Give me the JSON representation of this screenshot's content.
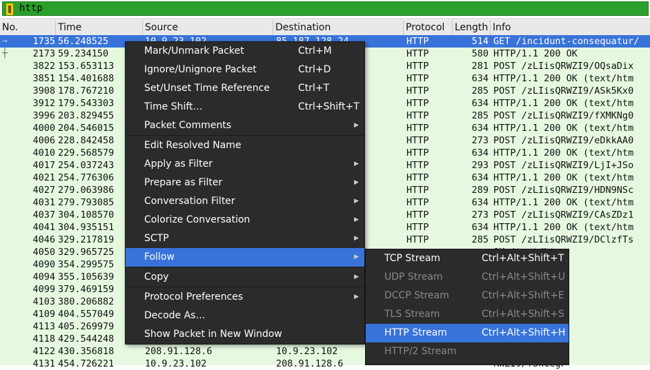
{
  "filter": {
    "text": "http",
    "bg_color": "#2ca02c"
  },
  "columns": [
    "No.",
    "Time",
    "Source",
    "Destination",
    "Protocol",
    "Length",
    "Info"
  ],
  "rows": [
    {
      "no": "1735",
      "time": "56.248525",
      "src": "10.9.23.102",
      "dst": "85.187.128.24",
      "proto": "HTTP",
      "len": "514",
      "info": "GET /incidunt-consequatur/"
    },
    {
      "no": "2173",
      "time": "59.234150",
      "src": "",
      "dst": "",
      "proto": "HTTP",
      "len": "580",
      "info": "HTTP/1.1 200 OK"
    },
    {
      "no": "3822",
      "time": "153.653113",
      "src": "",
      "dst": "",
      "proto": "HTTP",
      "len": "281",
      "info": "POST /zLIisQRWZI9/OQsaDix"
    },
    {
      "no": "3851",
      "time": "154.401688",
      "src": "",
      "dst": "",
      "proto": "HTTP",
      "len": "634",
      "info": "HTTP/1.1 200 OK  (text/htm"
    },
    {
      "no": "3908",
      "time": "178.767210",
      "src": "",
      "dst": "",
      "proto": "HTTP",
      "len": "285",
      "info": "POST /zLIisQRWZI9/ASk5Kx0"
    },
    {
      "no": "3912",
      "time": "179.543303",
      "src": "",
      "dst": "",
      "proto": "HTTP",
      "len": "634",
      "info": "HTTP/1.1 200 OK  (text/htm"
    },
    {
      "no": "3996",
      "time": "203.829455",
      "src": "",
      "dst": "",
      "proto": "HTTP",
      "len": "285",
      "info": "POST /zLIisQRWZI9/fXMKNg0"
    },
    {
      "no": "4000",
      "time": "204.546015",
      "src": "",
      "dst": "",
      "proto": "HTTP",
      "len": "634",
      "info": "HTTP/1.1 200 OK  (text/htm"
    },
    {
      "no": "4006",
      "time": "228.842458",
      "src": "",
      "dst": "",
      "proto": "HTTP",
      "len": "273",
      "info": "POST /zLIisQRWZI9/eDkkAA0"
    },
    {
      "no": "4010",
      "time": "229.568579",
      "src": "",
      "dst": "",
      "proto": "HTTP",
      "len": "634",
      "info": "HTTP/1.1 200 OK  (text/htm"
    },
    {
      "no": "4017",
      "time": "254.037243",
      "src": "",
      "dst": "",
      "proto": "HTTP",
      "len": "293",
      "info": "POST /zLIisQRWZI9/LjI+JSo"
    },
    {
      "no": "4021",
      "time": "254.776306",
      "src": "",
      "dst": "",
      "proto": "HTTP",
      "len": "634",
      "info": "HTTP/1.1 200 OK  (text/htm"
    },
    {
      "no": "4027",
      "time": "279.063986",
      "src": "",
      "dst": "",
      "proto": "HTTP",
      "len": "289",
      "info": "POST /zLIisQRWZI9/HDN9NSc"
    },
    {
      "no": "4031",
      "time": "279.793085",
      "src": "",
      "dst": "",
      "proto": "HTTP",
      "len": "634",
      "info": "HTTP/1.1 200 OK  (text/htm"
    },
    {
      "no": "4037",
      "time": "304.108570",
      "src": "",
      "dst": "",
      "proto": "HTTP",
      "len": "273",
      "info": "POST /zLIisQRWZI9/CAsZDz1"
    },
    {
      "no": "4041",
      "time": "304.935151",
      "src": "",
      "dst": "",
      "proto": "HTTP",
      "len": "634",
      "info": "HTTP/1.1 200 OK  (text/htm"
    },
    {
      "no": "4046",
      "time": "329.217819",
      "src": "",
      "dst": "",
      "proto": "HTTP",
      "len": "285",
      "info": "POST /zLIisQRWZI9/DClzfTs"
    },
    {
      "no": "4050",
      "time": "329.965725",
      "src": "",
      "dst": "",
      "proto": "",
      "len": "",
      "info": "OK  (text/htm"
    },
    {
      "no": "4090",
      "time": "354.299575",
      "src": "",
      "dst": "",
      "proto": "",
      "len": "",
      "info": "RWZI9/EgwECwQ"
    },
    {
      "no": "4094",
      "time": "355.105639",
      "src": "",
      "dst": "",
      "proto": "",
      "len": "",
      "info": "OK  (text/htm"
    },
    {
      "no": "4099",
      "time": "379.469159",
      "src": "",
      "dst": "",
      "proto": "",
      "len": "",
      "info": "RWZI9/GB0tLyc"
    },
    {
      "no": "4103",
      "time": "380.206882",
      "src": "",
      "dst": "",
      "proto": "",
      "len": "",
      "info": "OK  (text/htm"
    },
    {
      "no": "4109",
      "time": "404.557049",
      "src": "",
      "dst": "",
      "proto": "",
      "len": "",
      "info": "RWZI9/EgwSFkZ"
    },
    {
      "no": "4113",
      "time": "405.269979",
      "src": "",
      "dst": "",
      "proto": "",
      "len": "",
      "info": "OK  (text/htm"
    },
    {
      "no": "4118",
      "time": "429.544248",
      "src": "",
      "dst": "",
      "proto": "",
      "len": "",
      "info": "RWZI9/CXwgNgI"
    },
    {
      "no": "4122",
      "time": "430.356818",
      "src": "208.91.128.6",
      "dst": "10.9.23.102",
      "proto": "",
      "len": "",
      "info": "OK  (text/htm"
    },
    {
      "no": "4131",
      "time": "454.726221",
      "src": "10.9.23.102",
      "dst": "208.91.128.6",
      "proto": "",
      "len": "",
      "info": "RWZI9/fSkCegF"
    }
  ],
  "context_menu": {
    "items": [
      {
        "label": "Mark/Unmark Packet",
        "shortcut": "Ctrl+M",
        "submenu": false
      },
      {
        "label": "Ignore/Unignore Packet",
        "shortcut": "Ctrl+D",
        "submenu": false
      },
      {
        "label": "Set/Unset Time Reference",
        "shortcut": "Ctrl+T",
        "submenu": false
      },
      {
        "label": "Time Shift…",
        "shortcut": "Ctrl+Shift+T",
        "submenu": false
      },
      {
        "label": "Packet Comments",
        "shortcut": "",
        "submenu": true
      },
      {
        "label": "Edit Resolved Name",
        "shortcut": "",
        "submenu": false
      },
      {
        "label": "Apply as Filter",
        "shortcut": "",
        "submenu": true
      },
      {
        "label": "Prepare as Filter",
        "shortcut": "",
        "submenu": true
      },
      {
        "label": "Conversation Filter",
        "shortcut": "",
        "submenu": true
      },
      {
        "label": "Colorize Conversation",
        "shortcut": "",
        "submenu": true
      },
      {
        "label": "SCTP",
        "shortcut": "",
        "submenu": true
      },
      {
        "label": "Follow",
        "shortcut": "",
        "submenu": true
      },
      {
        "label": "Copy",
        "shortcut": "",
        "submenu": true
      },
      {
        "label": "Protocol Preferences",
        "shortcut": "",
        "submenu": true
      },
      {
        "label": "Decode As…",
        "shortcut": "",
        "submenu": false
      },
      {
        "label": "Show Packet in New Window",
        "shortcut": "",
        "submenu": false
      }
    ]
  },
  "follow_submenu": {
    "items": [
      {
        "label": "TCP Stream",
        "shortcut": "Ctrl+Alt+Shift+T",
        "disabled": false
      },
      {
        "label": "UDP Stream",
        "shortcut": "Ctrl+Alt+Shift+U",
        "disabled": true
      },
      {
        "label": "DCCP Stream",
        "shortcut": "Ctrl+Alt+Shift+E",
        "disabled": true
      },
      {
        "label": "TLS Stream",
        "shortcut": "Ctrl+Alt+Shift+S",
        "disabled": true
      },
      {
        "label": "HTTP Stream",
        "shortcut": "Ctrl+Alt+Shift+H",
        "disabled": false
      },
      {
        "label": "HTTP/2 Stream",
        "shortcut": "",
        "disabled": true
      }
    ]
  },
  "colors": {
    "selected_row": "#3873d9",
    "row_bg": "#e6f9e0",
    "menu_bg": "#2b2b2b",
    "highlight": "#3873d9"
  }
}
